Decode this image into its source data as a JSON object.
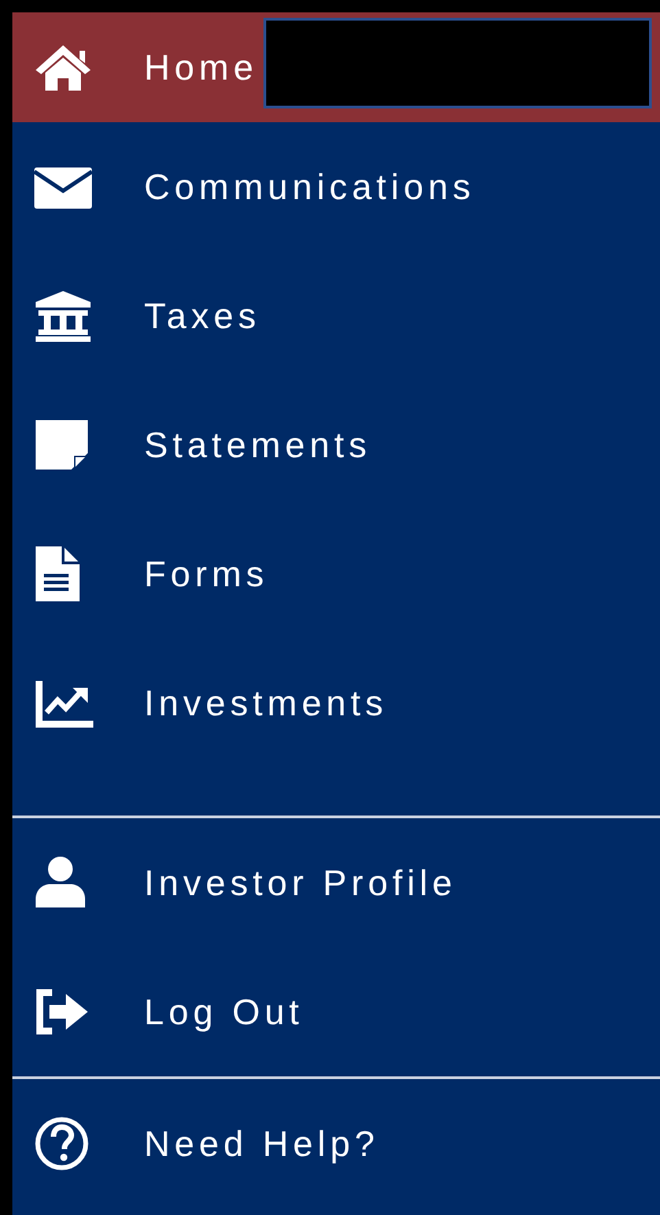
{
  "menu": {
    "sections": [
      {
        "items": [
          {
            "label": "Home",
            "kind": "home",
            "selected": true,
            "redacted": true
          },
          {
            "label": "Communications",
            "kind": "mail",
            "selected": false
          },
          {
            "label": "Taxes",
            "kind": "bank",
            "selected": false
          },
          {
            "label": "Statements",
            "kind": "note",
            "selected": false
          },
          {
            "label": "Forms",
            "kind": "document",
            "selected": false
          },
          {
            "label": "Investments",
            "kind": "chart",
            "selected": false
          }
        ]
      },
      {
        "items": [
          {
            "label": "Investor Profile",
            "kind": "user",
            "selected": false
          },
          {
            "label": "Log Out",
            "kind": "logout",
            "selected": false
          }
        ]
      },
      {
        "items": [
          {
            "label": "Need Help?",
            "kind": "help",
            "selected": false
          }
        ]
      }
    ]
  }
}
